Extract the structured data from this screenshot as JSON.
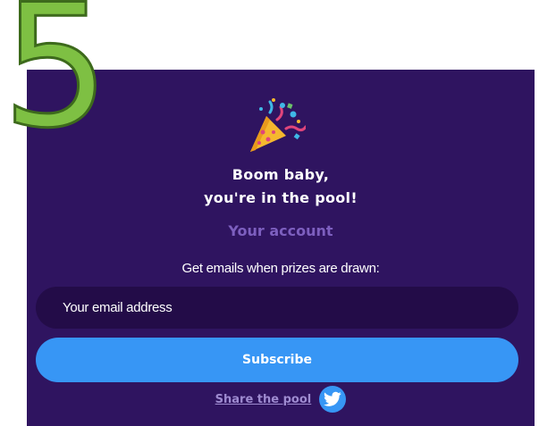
{
  "step": {
    "number": "5"
  },
  "success": {
    "headline_line1": "Boom baby,",
    "headline_line2": "you're in the pool!",
    "icon": "party-popper-icon"
  },
  "account": {
    "link_label": "Your account"
  },
  "subscribe": {
    "prompt": "Get emails when prizes are drawn:",
    "email_placeholder": "Your email address",
    "email_value": "",
    "button_label": "Subscribe"
  },
  "share": {
    "link_label": "Share the pool",
    "icon": "twitter-icon"
  },
  "colors": {
    "panel_background": "#2f1460",
    "input_background": "#230c48",
    "accent_blue": "#3796f5",
    "account_link": "#7d5fbf",
    "share_link": "#9e8bd0",
    "step_number": "#7ec043"
  }
}
